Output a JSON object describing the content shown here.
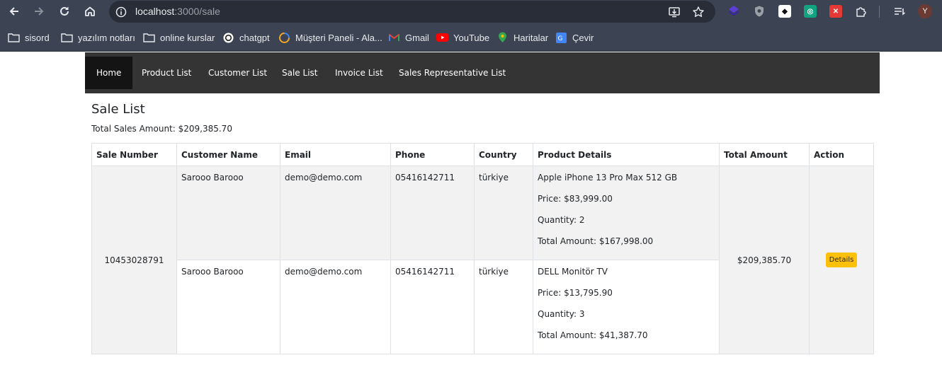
{
  "browser": {
    "url_host": "localhost",
    "url_path": ":3000/sale",
    "profile_initial": "Y",
    "bookmarks": [
      {
        "label": "sisord",
        "icon": "folder-icon"
      },
      {
        "label": "yazılım notları",
        "icon": "folder-icon"
      },
      {
        "label": "online kurslar",
        "icon": "folder-icon"
      },
      {
        "label": "chatgpt",
        "icon": "chatgpt-icon"
      },
      {
        "label": "Müşteri Paneli - Ala...",
        "icon": "panel-icon"
      },
      {
        "label": "Gmail",
        "icon": "gmail-icon"
      },
      {
        "label": "YouTube",
        "icon": "youtube-icon"
      },
      {
        "label": "Haritalar",
        "icon": "maps-icon"
      },
      {
        "label": "Çevir",
        "icon": "translate-icon"
      }
    ]
  },
  "navbar": {
    "items": [
      {
        "label": "Home",
        "active": true
      },
      {
        "label": "Product List",
        "active": false
      },
      {
        "label": "Customer List",
        "active": false
      },
      {
        "label": "Sale List",
        "active": false
      },
      {
        "label": "Invoice List",
        "active": false
      },
      {
        "label": "Sales Representative List",
        "active": false
      }
    ]
  },
  "page": {
    "title": "Sale List",
    "total_label": "Total Sales Amount: $209,385.70"
  },
  "table": {
    "headers": [
      "Sale Number",
      "Customer Name",
      "Email",
      "Phone",
      "Country",
      "Product Details",
      "Total Amount",
      "Action"
    ],
    "sale": {
      "sale_number": "10453028791",
      "total_amount": "$209,385.70",
      "action_label": "Details",
      "lines": [
        {
          "customer": "Sarooo Barooo",
          "email": "demo@demo.com",
          "phone": "05416142711",
          "country": "türkiye",
          "product": "Apple iPhone 13 Pro Max 512 GB",
          "price": "Price: $83,999.00",
          "quantity": "Quantity: 2",
          "total": "Total Amount: $167,998.00"
        },
        {
          "customer": "Sarooo Barooo",
          "email": "demo@demo.com",
          "phone": "05416142711",
          "country": "türkiye",
          "product": "DELL Monitör TV",
          "price": "Price: $13,795.90",
          "quantity": "Quantity: 3",
          "total": "Total Amount: $41,387.70"
        }
      ]
    }
  },
  "colors": {
    "chrome_bg": "#3c4454",
    "navbar_bg": "#343434",
    "navbar_active_bg": "#141414",
    "details_button": "#ffc107",
    "striped_row": "#f2f2f2"
  }
}
